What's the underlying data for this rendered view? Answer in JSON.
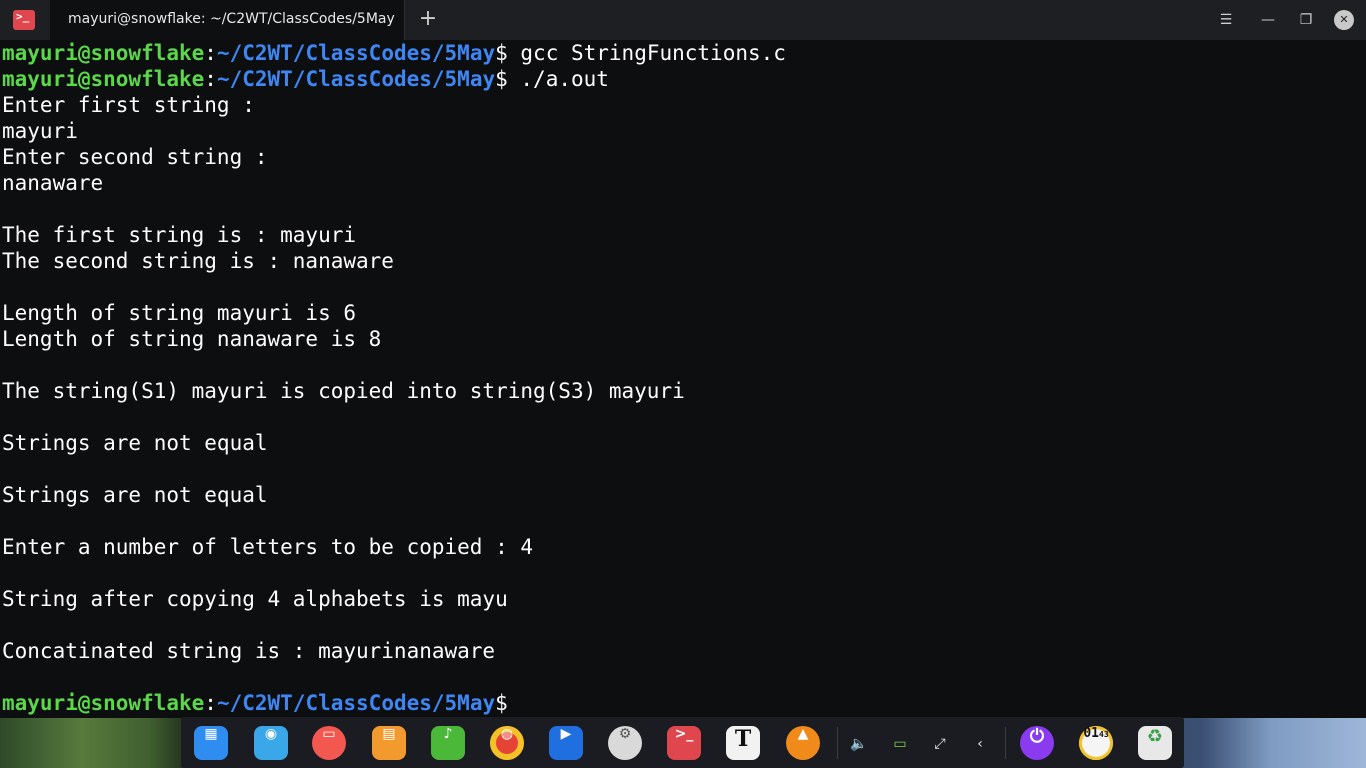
{
  "titlebar": {
    "app_icon": "terminal-icon",
    "tab_title": "mayuri@snowflake: ~/C2WT/ClassCodes/5May",
    "new_tab": "+",
    "menu": "☰",
    "minimize": "—",
    "maximize": "❐",
    "close": "✕"
  },
  "terminal": {
    "prompt_user": "mayuri@snowflake",
    "prompt_sep": ":",
    "prompt_path": "~/C2WT/ClassCodes/5May",
    "prompt_symbol": "$",
    "commands": [
      " gcc StringFunctions.c",
      " ./a.out",
      ""
    ],
    "output": [
      "Enter first string :",
      "mayuri",
      "Enter second string :",
      "nanaware",
      "",
      "The first string is : mayuri",
      "The second string is : nanaware",
      "",
      "Length of string mayuri is 6",
      "Length of string nanaware is 8",
      "",
      "The string(S1) mayuri is copied into string(S3) mayuri",
      "",
      "Strings are not equal",
      "",
      "Strings are not equal",
      "",
      "Enter a number of letters to be copied : 4",
      "",
      "String after copying 4 alphabets is mayu",
      "",
      "Concatinated string is : mayurinanaware"
    ]
  },
  "dock": {
    "apps": [
      {
        "name": "launcher-icon",
        "glyph": "▦",
        "color": "#2f8cf0"
      },
      {
        "name": "file-manager-icon",
        "glyph": "◉",
        "color": "#3aa7e8"
      },
      {
        "name": "screen-recorder-icon",
        "glyph": "▭",
        "color": "#f2584f"
      },
      {
        "name": "app-store-icon",
        "glyph": "▤",
        "color": "#f29a2e"
      },
      {
        "name": "music-player-icon",
        "glyph": "♪",
        "color": "#4bb83a"
      },
      {
        "name": "chrome-icon",
        "glyph": "◍",
        "color": "#e54335"
      },
      {
        "name": "video-player-icon",
        "glyph": "▶",
        "color": "#1f6fe0"
      },
      {
        "name": "settings-icon",
        "glyph": "⚙",
        "color": "#d9d9d9"
      },
      {
        "name": "terminal-app-icon",
        "glyph": ">_",
        "color": "#e0464e"
      },
      {
        "name": "text-editor-icon",
        "glyph": "T",
        "color": "#f2f2f2"
      },
      {
        "name": "vlc-icon",
        "glyph": "▲",
        "color": "#f08a1a"
      }
    ],
    "tray": {
      "volume": "🔈",
      "battery": "▭",
      "network": "⤢",
      "expand": "‹"
    },
    "power": "⏻",
    "clock": {
      "hour": "01",
      "minute": "43"
    },
    "trash": "♻"
  }
}
